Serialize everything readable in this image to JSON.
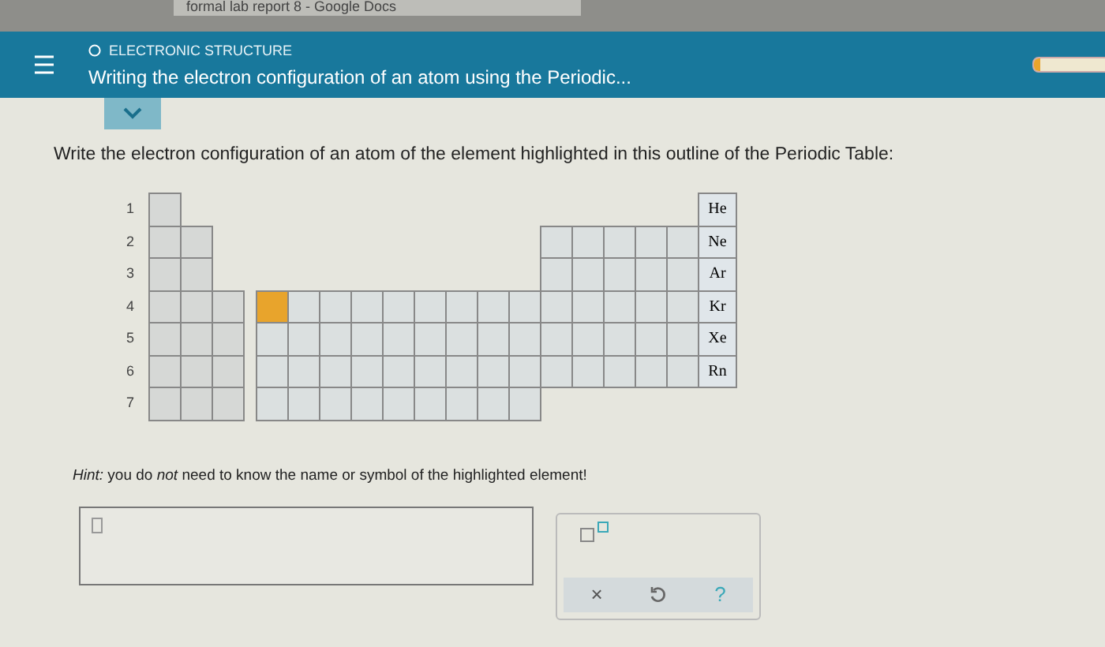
{
  "browser_tab": {
    "title": "formal lab report 8 - Google Docs"
  },
  "header": {
    "topic": "ELECTRONIC STRUCTURE",
    "title": "Writing the electron configuration of an atom using the Periodic...",
    "progress": {
      "level": 0.08
    }
  },
  "question": "Write the electron configuration of an atom of the element highlighted in this outline of the Periodic Table:",
  "periodic_table": {
    "periods": [
      {
        "label": "1",
        "noble_gas": "He"
      },
      {
        "label": "2",
        "noble_gas": "Ne"
      },
      {
        "label": "3",
        "noble_gas": "Ar"
      },
      {
        "label": "4",
        "noble_gas": "Kr",
        "transition_cells": [
          {
            "selected": true
          },
          {
            "selected": false
          },
          {
            "selected": false
          },
          {
            "selected": false
          },
          {
            "selected": false
          },
          {
            "selected": false
          },
          {
            "selected": false
          },
          {
            "selected": false
          },
          {
            "selected": false
          }
        ]
      },
      {
        "label": "5",
        "noble_gas": "Xe",
        "transition_cells": [
          {
            "selected": false
          },
          {
            "selected": false
          },
          {
            "selected": false
          },
          {
            "selected": false
          },
          {
            "selected": false
          },
          {
            "selected": false
          },
          {
            "selected": false
          },
          {
            "selected": false
          },
          {
            "selected": false
          }
        ]
      },
      {
        "label": "6",
        "noble_gas": "Rn",
        "transition_cells": [
          {
            "selected": false
          },
          {
            "selected": false
          },
          {
            "selected": false
          },
          {
            "selected": false
          },
          {
            "selected": false
          },
          {
            "selected": false
          },
          {
            "selected": false
          },
          {
            "selected": false
          },
          {
            "selected": false
          }
        ]
      },
      {
        "label": "7",
        "transition_cells": [
          {
            "selected": false
          },
          {
            "selected": false
          },
          {
            "selected": false
          },
          {
            "selected": false
          },
          {
            "selected": false
          },
          {
            "selected": false
          },
          {
            "selected": false
          },
          {
            "selected": false
          },
          {
            "selected": false
          }
        ]
      }
    ]
  },
  "hint": "*Hint:* you do *not* need to know the name or symbol of the highlighted element!",
  "tools": {
    "clear": "×",
    "help": "?"
  }
}
